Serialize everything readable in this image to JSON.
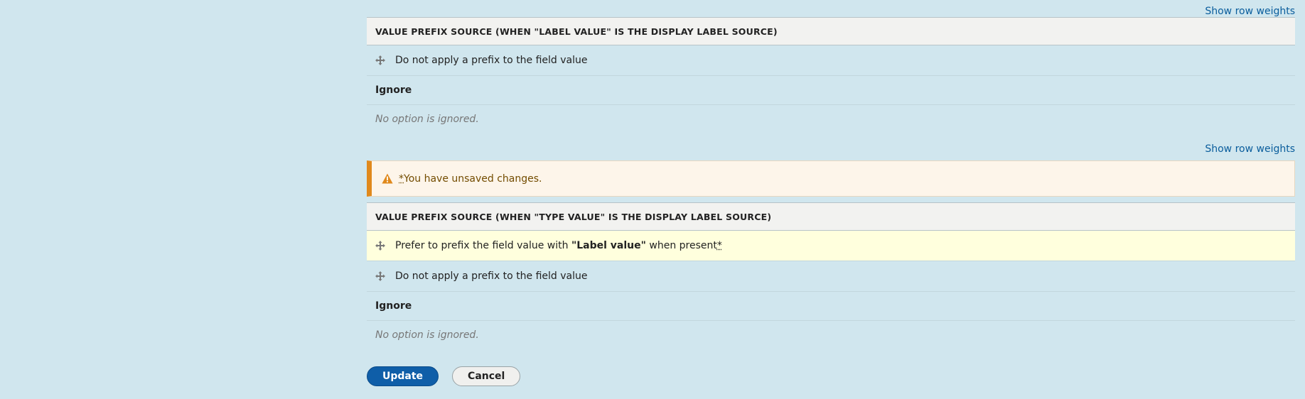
{
  "show_row_weights": "Show row weights",
  "section1": {
    "header": "VALUE PREFIX SOURCE (WHEN \"LABEL VALUE\" IS THE DISPLAY LABEL SOURCE)",
    "rows": [
      "Do not apply a prefix to the field value"
    ],
    "region_label": "Ignore",
    "empty_text": "No option is ignored."
  },
  "warning": {
    "star": "*",
    "text": " You have unsaved changes."
  },
  "section2": {
    "header": "VALUE PREFIX SOURCE (WHEN \"TYPE VALUE\" IS THE DISPLAY LABEL SOURCE)",
    "changed_row": {
      "before": "Prefer to prefix the field value with ",
      "bold": "\"Label value\"",
      "after": " when present",
      "star": "*"
    },
    "rows": [
      "Do not apply a prefix to the field value"
    ],
    "region_label": "Ignore",
    "empty_text": "No option is ignored."
  },
  "buttons": {
    "update": "Update",
    "cancel": "Cancel"
  },
  "colors": {
    "background": "#d0e6ee",
    "link": "#0a5d9c",
    "warning_accent": "#e0891c",
    "changed_row": "#ffffdd",
    "primary_button": "#0f5ea8"
  },
  "icons": [
    "drag-handle-icon",
    "warning-icon"
  ]
}
